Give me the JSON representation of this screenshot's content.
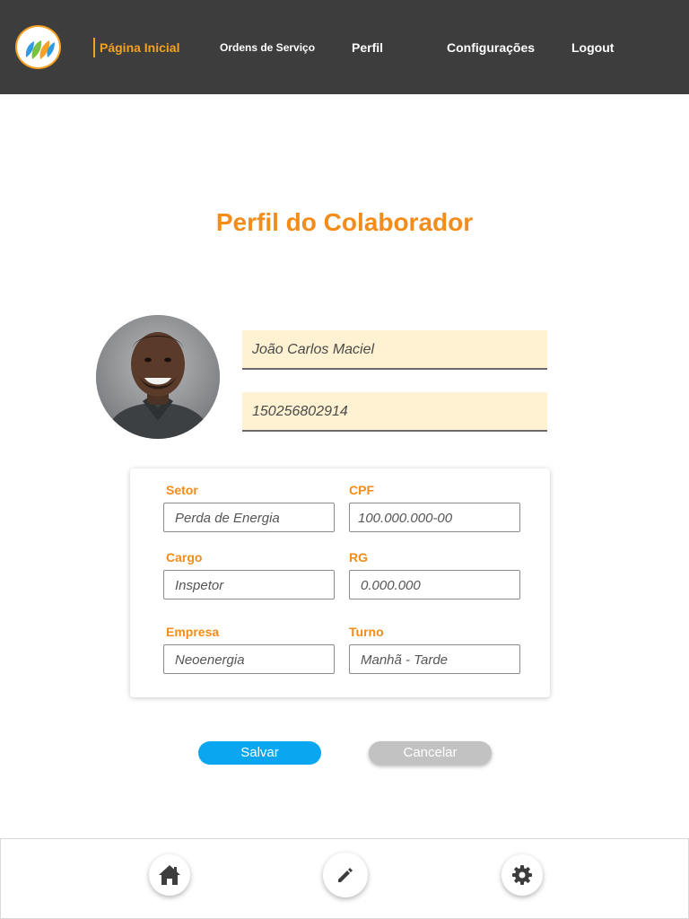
{
  "nav": {
    "items": [
      {
        "label": "Página Inicial"
      },
      {
        "label": "Ordens de Serviço"
      },
      {
        "label": "Perfil"
      },
      {
        "label": "Configurações"
      },
      {
        "label": "Logout"
      }
    ]
  },
  "page": {
    "title": "Perfil do Colaborador"
  },
  "profile": {
    "name": "João Carlos Maciel",
    "id": "150256802914"
  },
  "details": {
    "setor": {
      "label": "Setor",
      "value": "Perda de Energia"
    },
    "cpf": {
      "label": "CPF",
      "value": "100.000.000-00"
    },
    "cargo": {
      "label": "Cargo",
      "value": "Inspetor"
    },
    "rg": {
      "label": "RG",
      "value": "0.000.000"
    },
    "empresa": {
      "label": "Empresa",
      "value": "Neoenergia"
    },
    "turno": {
      "label": "Turno",
      "value": "Manhã - Tarde"
    }
  },
  "actions": {
    "save_label": "Salvar",
    "cancel_label": "Cancelar"
  },
  "bottom_nav": {
    "icons": [
      "home-icon",
      "pencil-icon",
      "gear-icon"
    ]
  },
  "colors": {
    "accent": "#f28c1a",
    "header_bg": "#3d3d3d",
    "primary_button": "#0aa6f0",
    "secondary_button": "#c2c2c2",
    "field_highlight": "#fff2d2"
  }
}
